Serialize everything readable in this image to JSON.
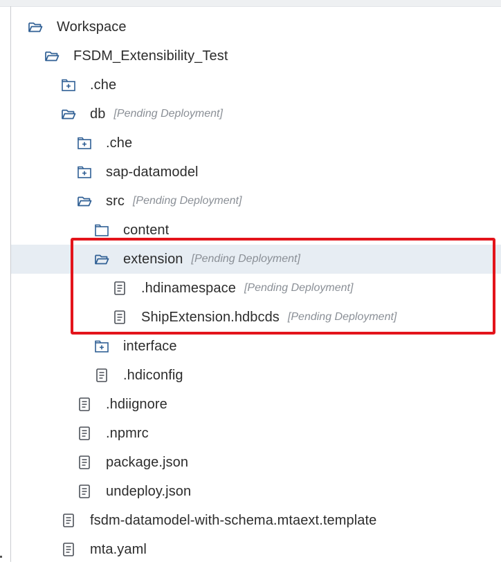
{
  "tree": {
    "items": [
      {
        "label": "Workspace",
        "status": "",
        "icon": "folder-open-icon"
      },
      {
        "label": "FSDM_Extensibility_Test",
        "status": "",
        "icon": "folder-open-icon"
      },
      {
        "label": ".che",
        "status": "",
        "icon": "folder-plus-icon"
      },
      {
        "label": "db",
        "status": "[Pending Deployment]",
        "icon": "folder-open-icon"
      },
      {
        "label": ".che",
        "status": "",
        "icon": "folder-plus-icon"
      },
      {
        "label": "sap-datamodel",
        "status": "",
        "icon": "folder-plus-icon"
      },
      {
        "label": "src",
        "status": "[Pending Deployment]",
        "icon": "folder-open-icon"
      },
      {
        "label": "content",
        "status": "",
        "icon": "folder-empty-icon"
      },
      {
        "label": "extension",
        "status": "[Pending Deployment]",
        "icon": "folder-open-icon"
      },
      {
        "label": ".hdinamespace",
        "status": "[Pending Deployment]",
        "icon": "file-icon"
      },
      {
        "label": "ShipExtension.hdbcds",
        "status": "[Pending Deployment]",
        "icon": "file-icon"
      },
      {
        "label": "interface",
        "status": "",
        "icon": "folder-plus-icon"
      },
      {
        "label": ".hdiconfig",
        "status": "",
        "icon": "file-icon"
      },
      {
        "label": ".hdiignore",
        "status": "",
        "icon": "file-icon"
      },
      {
        "label": ".npmrc",
        "status": "",
        "icon": "file-icon"
      },
      {
        "label": "package.json",
        "status": "",
        "icon": "file-icon"
      },
      {
        "label": "undeploy.json",
        "status": "",
        "icon": "file-icon"
      },
      {
        "label": "fsdm-datamodel-with-schema.mtaext.template",
        "status": "",
        "icon": "file-icon"
      },
      {
        "label": "mta.yaml",
        "status": "",
        "icon": "file-icon"
      }
    ],
    "selected_label": "extension"
  },
  "colors": {
    "icon": "#2f5f94",
    "highlight_border": "#e3141b",
    "selected_row": "#e7edf3",
    "status_text": "#8a8f96"
  }
}
